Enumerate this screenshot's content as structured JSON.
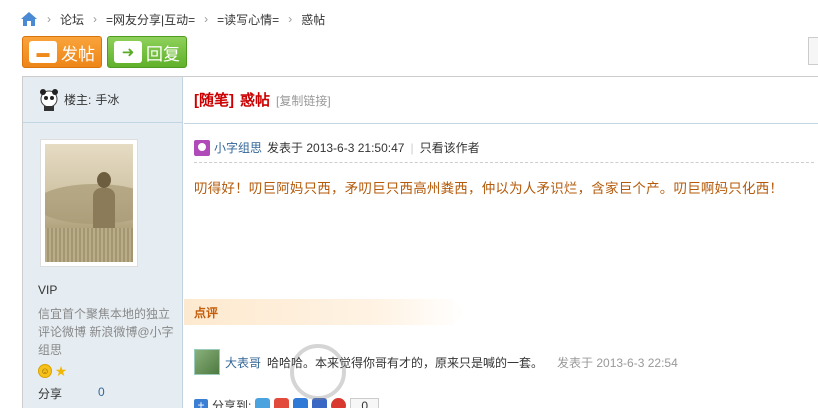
{
  "breadcrumb": {
    "items": [
      "论坛",
      "=网友分享|互动=",
      "=读写心情=",
      "惑帖"
    ]
  },
  "toolbar": {
    "post_label": "发帖",
    "reply_label": "回复"
  },
  "sidebar": {
    "owner_label": "楼主:",
    "owner_name": "手冰",
    "level": "VIP",
    "signature": "信宜首个聚焦本地的独立评论微博 新浪微博@小字组思",
    "stats": [
      {
        "label": "分享",
        "value": "0"
      }
    ]
  },
  "thread": {
    "category": "[随笔]",
    "title": "惑帖",
    "copy_link": "[复制链接]",
    "author": "小字组思",
    "posted_prefix": "发表于 2013-6-3 21:50:47",
    "only_author": "只看该作者",
    "body": "叨得好！叨巨阿妈只西，矛叨巨只西高州粪西，仲以为人矛识烂，含家巨个产。叨巨啊妈只化西！"
  },
  "comments": {
    "header": "点评",
    "items": [
      {
        "name": "大表哥",
        "text": "哈哈哈。本来觉得你哥有才的，原来只是喊的一套。",
        "time": "发表于 2013-6-3 22:54"
      }
    ]
  },
  "share": {
    "label": "分享到:",
    "count": "0"
  },
  "colors": {
    "sidebar_bg": "#e5edf2",
    "title_red": "#cc0000",
    "body_orange": "#b45a0a",
    "link_blue": "#336699",
    "post_button": "#f39a2a",
    "reply_button": "#72bd3c"
  },
  "icons": {
    "home": "home-icon",
    "post": "speech-bubble-icon",
    "reply": "reply-arrow-icon"
  }
}
